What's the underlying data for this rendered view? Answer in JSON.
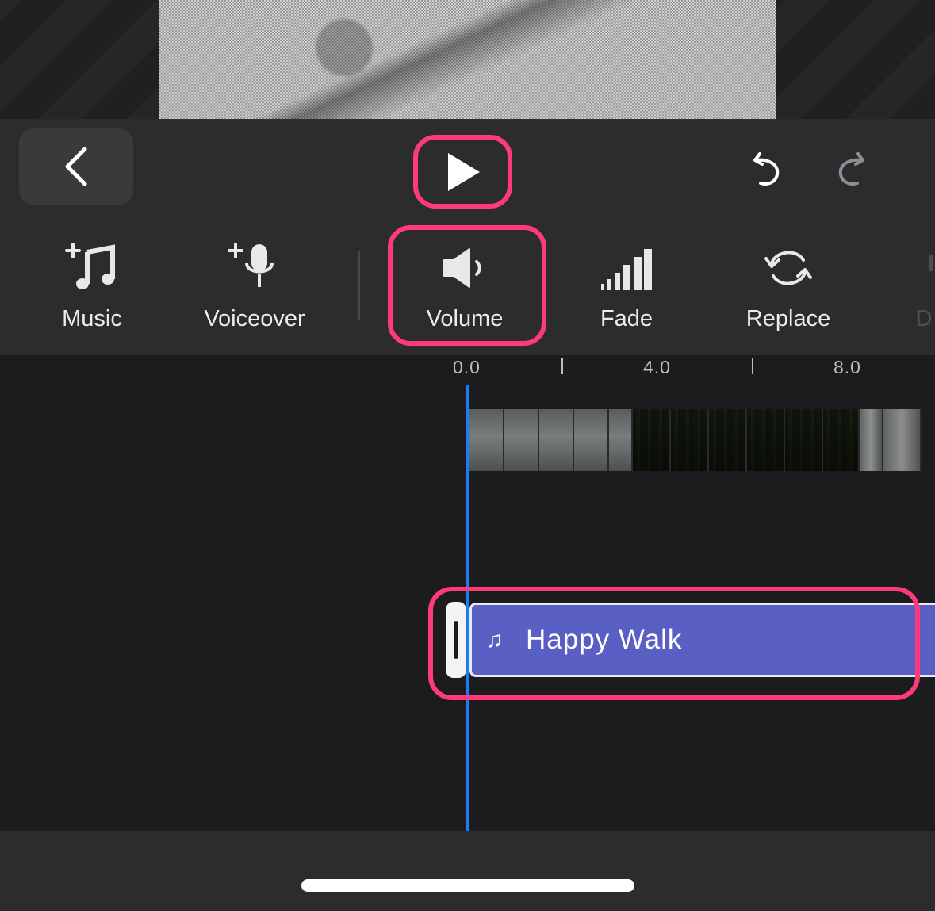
{
  "toolbar": {
    "back": {
      "icon": "chevron-left-icon"
    },
    "play": {
      "icon": "play-icon"
    },
    "undo": {
      "icon": "undo-icon"
    },
    "redo": {
      "icon": "redo-icon",
      "enabled": false
    }
  },
  "tools": [
    {
      "label": "Music",
      "icon": "add-music-icon"
    },
    {
      "label": "Voiceover",
      "icon": "add-voiceover-icon"
    },
    {
      "label": "Volume",
      "icon": "speaker-icon"
    },
    {
      "label": "Fade",
      "icon": "fade-bars-icon"
    },
    {
      "label": "Replace",
      "icon": "replace-icon"
    },
    {
      "label": "D",
      "icon": "partial-tool-icon"
    }
  ],
  "timeline": {
    "ruler": [
      "0.0",
      "4.0",
      "8.0"
    ],
    "audio_clip": {
      "title": "Happy Walk",
      "icon": "music-note-icon"
    }
  },
  "colors": {
    "highlight": "#ff3a78",
    "playhead": "#1e7cf2",
    "audio_clip": "#5a5fc4"
  }
}
